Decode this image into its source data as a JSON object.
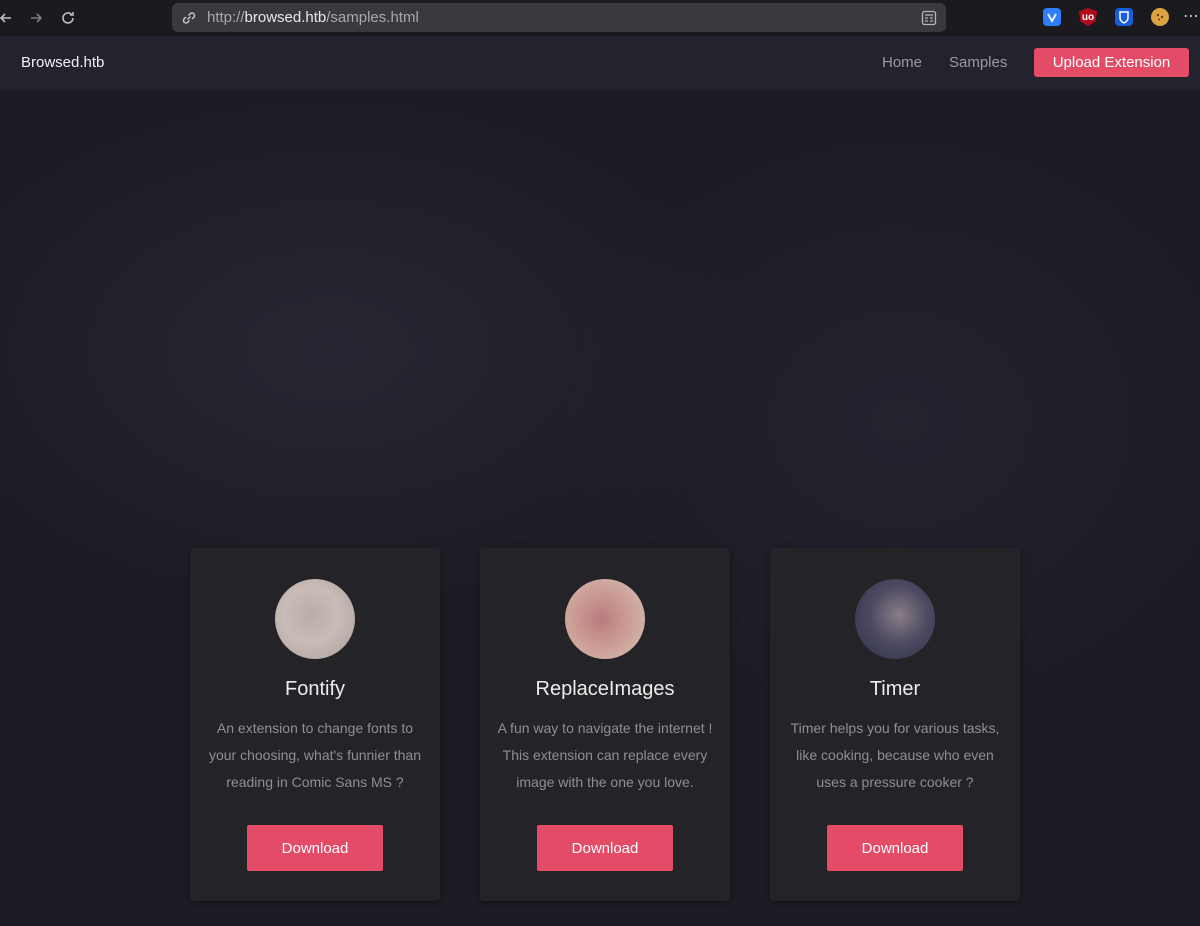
{
  "browser": {
    "url_scheme": "http://",
    "url_host": "browsed.htb",
    "url_path": "/samples.html",
    "back_icon": "arrow-left-icon",
    "forward_icon": "arrow-right-icon",
    "reload_icon": "reload-icon",
    "extensions": [
      {
        "name": "vpn-extension-icon",
        "color": "#2d7ff9",
        "glyph": "V"
      },
      {
        "name": "ublock-origin-icon",
        "color": "#b40b1c",
        "glyph": "uo"
      },
      {
        "name": "bitwarden-icon",
        "color": "#175ddc",
        "glyph": "U"
      },
      {
        "name": "cookie-extension-icon",
        "color": "#d9a441",
        "glyph": "●"
      }
    ],
    "menu_glyph": "⋯"
  },
  "site_nav": {
    "brand": "Browsed.htb",
    "links": [
      "Home",
      "Samples"
    ],
    "upload_label": "Upload Extension"
  },
  "colors": {
    "accent": "#e34b66",
    "card_bg": "#242428",
    "page_bg": "#1c1c25"
  },
  "cards": [
    {
      "title": "Fontify",
      "description": "An extension to change fonts to your choosing, what's funnier than reading in Comic Sans MS ?",
      "button": "Download"
    },
    {
      "title": "ReplaceImages",
      "description": "A fun way to navigate the internet ! This extension can replace every image with the one you love.",
      "button": "Download"
    },
    {
      "title": "Timer",
      "description": "Timer helps you for various tasks, like cooking, because who even uses a pressure cooker ?",
      "button": "Download"
    }
  ]
}
